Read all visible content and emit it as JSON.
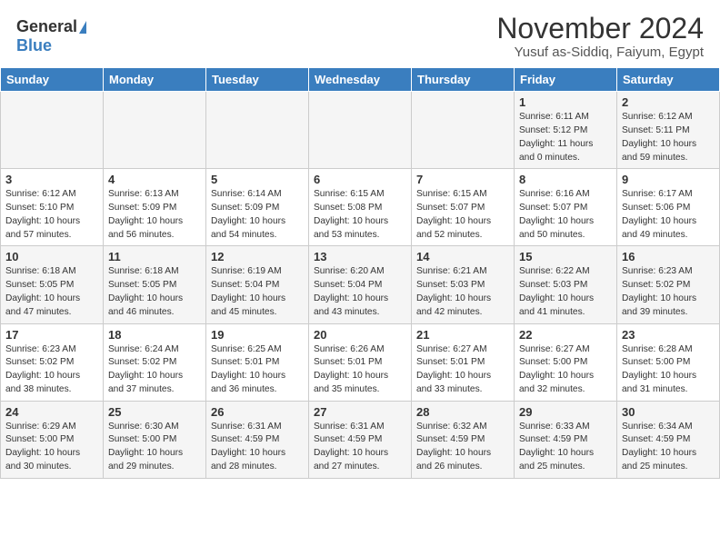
{
  "header": {
    "logo_general": "General",
    "logo_blue": "Blue",
    "title": "November 2024",
    "subtitle": "Yusuf as-Siddiq, Faiyum, Egypt"
  },
  "weekdays": [
    "Sunday",
    "Monday",
    "Tuesday",
    "Wednesday",
    "Thursday",
    "Friday",
    "Saturday"
  ],
  "weeks": [
    [
      {
        "day": "",
        "detail": ""
      },
      {
        "day": "",
        "detail": ""
      },
      {
        "day": "",
        "detail": ""
      },
      {
        "day": "",
        "detail": ""
      },
      {
        "day": "",
        "detail": ""
      },
      {
        "day": "1",
        "detail": "Sunrise: 6:11 AM\nSunset: 5:12 PM\nDaylight: 11 hours\nand 0 minutes."
      },
      {
        "day": "2",
        "detail": "Sunrise: 6:12 AM\nSunset: 5:11 PM\nDaylight: 10 hours\nand 59 minutes."
      }
    ],
    [
      {
        "day": "3",
        "detail": "Sunrise: 6:12 AM\nSunset: 5:10 PM\nDaylight: 10 hours\nand 57 minutes."
      },
      {
        "day": "4",
        "detail": "Sunrise: 6:13 AM\nSunset: 5:09 PM\nDaylight: 10 hours\nand 56 minutes."
      },
      {
        "day": "5",
        "detail": "Sunrise: 6:14 AM\nSunset: 5:09 PM\nDaylight: 10 hours\nand 54 minutes."
      },
      {
        "day": "6",
        "detail": "Sunrise: 6:15 AM\nSunset: 5:08 PM\nDaylight: 10 hours\nand 53 minutes."
      },
      {
        "day": "7",
        "detail": "Sunrise: 6:15 AM\nSunset: 5:07 PM\nDaylight: 10 hours\nand 52 minutes."
      },
      {
        "day": "8",
        "detail": "Sunrise: 6:16 AM\nSunset: 5:07 PM\nDaylight: 10 hours\nand 50 minutes."
      },
      {
        "day": "9",
        "detail": "Sunrise: 6:17 AM\nSunset: 5:06 PM\nDaylight: 10 hours\nand 49 minutes."
      }
    ],
    [
      {
        "day": "10",
        "detail": "Sunrise: 6:18 AM\nSunset: 5:05 PM\nDaylight: 10 hours\nand 47 minutes."
      },
      {
        "day": "11",
        "detail": "Sunrise: 6:18 AM\nSunset: 5:05 PM\nDaylight: 10 hours\nand 46 minutes."
      },
      {
        "day": "12",
        "detail": "Sunrise: 6:19 AM\nSunset: 5:04 PM\nDaylight: 10 hours\nand 45 minutes."
      },
      {
        "day": "13",
        "detail": "Sunrise: 6:20 AM\nSunset: 5:04 PM\nDaylight: 10 hours\nand 43 minutes."
      },
      {
        "day": "14",
        "detail": "Sunrise: 6:21 AM\nSunset: 5:03 PM\nDaylight: 10 hours\nand 42 minutes."
      },
      {
        "day": "15",
        "detail": "Sunrise: 6:22 AM\nSunset: 5:03 PM\nDaylight: 10 hours\nand 41 minutes."
      },
      {
        "day": "16",
        "detail": "Sunrise: 6:23 AM\nSunset: 5:02 PM\nDaylight: 10 hours\nand 39 minutes."
      }
    ],
    [
      {
        "day": "17",
        "detail": "Sunrise: 6:23 AM\nSunset: 5:02 PM\nDaylight: 10 hours\nand 38 minutes."
      },
      {
        "day": "18",
        "detail": "Sunrise: 6:24 AM\nSunset: 5:02 PM\nDaylight: 10 hours\nand 37 minutes."
      },
      {
        "day": "19",
        "detail": "Sunrise: 6:25 AM\nSunset: 5:01 PM\nDaylight: 10 hours\nand 36 minutes."
      },
      {
        "day": "20",
        "detail": "Sunrise: 6:26 AM\nSunset: 5:01 PM\nDaylight: 10 hours\nand 35 minutes."
      },
      {
        "day": "21",
        "detail": "Sunrise: 6:27 AM\nSunset: 5:01 PM\nDaylight: 10 hours\nand 33 minutes."
      },
      {
        "day": "22",
        "detail": "Sunrise: 6:27 AM\nSunset: 5:00 PM\nDaylight: 10 hours\nand 32 minutes."
      },
      {
        "day": "23",
        "detail": "Sunrise: 6:28 AM\nSunset: 5:00 PM\nDaylight: 10 hours\nand 31 minutes."
      }
    ],
    [
      {
        "day": "24",
        "detail": "Sunrise: 6:29 AM\nSunset: 5:00 PM\nDaylight: 10 hours\nand 30 minutes."
      },
      {
        "day": "25",
        "detail": "Sunrise: 6:30 AM\nSunset: 5:00 PM\nDaylight: 10 hours\nand 29 minutes."
      },
      {
        "day": "26",
        "detail": "Sunrise: 6:31 AM\nSunset: 4:59 PM\nDaylight: 10 hours\nand 28 minutes."
      },
      {
        "day": "27",
        "detail": "Sunrise: 6:31 AM\nSunset: 4:59 PM\nDaylight: 10 hours\nand 27 minutes."
      },
      {
        "day": "28",
        "detail": "Sunrise: 6:32 AM\nSunset: 4:59 PM\nDaylight: 10 hours\nand 26 minutes."
      },
      {
        "day": "29",
        "detail": "Sunrise: 6:33 AM\nSunset: 4:59 PM\nDaylight: 10 hours\nand 25 minutes."
      },
      {
        "day": "30",
        "detail": "Sunrise: 6:34 AM\nSunset: 4:59 PM\nDaylight: 10 hours\nand 25 minutes."
      }
    ]
  ]
}
